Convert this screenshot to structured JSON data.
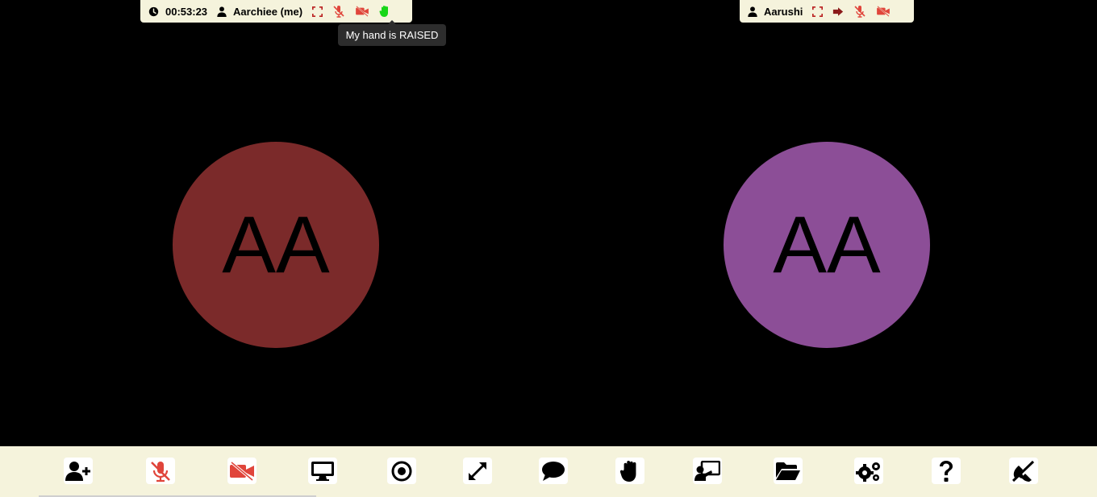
{
  "session": {
    "timer": "00:53:23",
    "self_name": "Aarchiee (me)",
    "self_initials": "AA",
    "peer_name": "Aarushi",
    "peer_initials": "AA",
    "hand_tooltip": "My hand is RAISED"
  },
  "colors": {
    "self_avatar": "#7b2a2a",
    "peer_avatar": "#8c4e97",
    "toolbar_bg": "#f5f3dc",
    "muted_red": "#e0453b",
    "hand_green": "#18d618"
  },
  "toolbar": {
    "buttons": [
      {
        "name": "add-participant",
        "icon": "user-plus-icon"
      },
      {
        "name": "microphone",
        "icon": "microphone-slash-icon",
        "state": "muted"
      },
      {
        "name": "camera",
        "icon": "video-slash-icon",
        "state": "off"
      },
      {
        "name": "share-screen",
        "icon": "desktop-icon"
      },
      {
        "name": "record",
        "icon": "record-icon"
      },
      {
        "name": "fullscreen",
        "icon": "expand-icon"
      },
      {
        "name": "chat",
        "icon": "chat-bubble-icon"
      },
      {
        "name": "raise-hand",
        "icon": "hand-icon"
      },
      {
        "name": "whiteboard",
        "icon": "presentation-icon"
      },
      {
        "name": "file-sharing",
        "icon": "folder-open-icon"
      },
      {
        "name": "settings",
        "icon": "gears-icon"
      },
      {
        "name": "help",
        "icon": "question-icon"
      },
      {
        "name": "leave-call",
        "icon": "phone-slash-icon"
      }
    ]
  }
}
